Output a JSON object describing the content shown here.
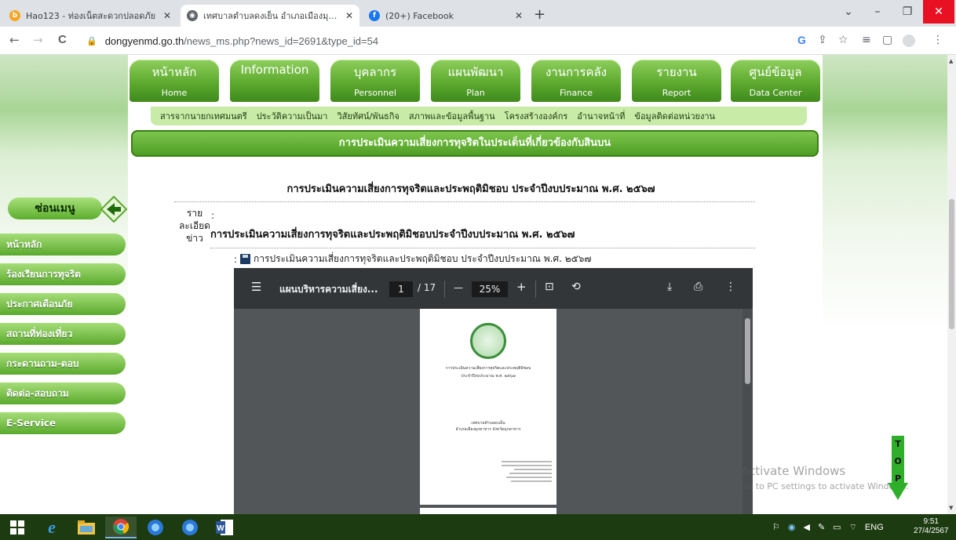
{
  "browser": {
    "tabs": [
      {
        "title": "Hao123 - ท่องเน็ตสะดวกปลอดภัย",
        "favicon_color": "#f5a623",
        "favicon": "b",
        "active": false
      },
      {
        "title": "เทศบาลตำบลดงเย็น อำเภอเมืองมุกดาห",
        "favicon_color": "#5f6368",
        "favicon": "◉",
        "active": true
      },
      {
        "title": "(20+) Facebook",
        "favicon_color": "#1877f2",
        "favicon": "f",
        "active": false
      }
    ],
    "new_tab": "+",
    "window_controls": {
      "dropdown": "⌄",
      "minimize": "–",
      "restore": "❐",
      "close": "✕"
    },
    "url_domain": "dongyenmd.go.th",
    "url_path": "/news_ms.php?news_id=2691&type_id=54",
    "nav": {
      "back": "←",
      "forward": "→",
      "reload": "C"
    }
  },
  "site": {
    "main_nav": [
      {
        "th": "หน้าหลัก",
        "en": "Home"
      },
      {
        "th": "Information",
        "en": ""
      },
      {
        "th": "บุคลากร",
        "en": "Personnel"
      },
      {
        "th": "แผนพัฒนา",
        "en": "Plan"
      },
      {
        "th": "งานการคลัง",
        "en": "Finance"
      },
      {
        "th": "รายงาน",
        "en": "Report"
      },
      {
        "th": "ศูนย์ข้อมูล",
        "en": "Data Center"
      }
    ],
    "sub_nav": [
      "สารจากนายกเทศมนตรี",
      "ประวัติความเป็นมา",
      "วิสัยทัศน์/พันธกิจ",
      "สภาพและข้อมูลพื้นฐาน",
      "โครงสร้างองค์กร",
      "อำนาจหน้าที่",
      "ข้อมูลติดต่อหน่วยงาน"
    ],
    "page_heading": "การประเมินความเสี่ยงการทุจริตในประเด็นที่เกี่ยวข้องกับสินบน",
    "left_menu_title": "ซ่อนเมนู",
    "left_menu": [
      "หน้าหลัก",
      "ร้องเรียนการทุจริต",
      "ประกาศเตือนภัย",
      "สถานที่ท่องเที่ยว",
      "กระดานถาม-ตอบ",
      "ติดต่อ-สอบถาม",
      "E-Service"
    ]
  },
  "article": {
    "title": "การประเมินความเสี่ยงการทุจริตและประพฤติมิชอบ ประจำปีงบประมาณ พ.ศ. ๒๕๖๗",
    "detail_label": "รายละเอียดข่าว",
    "detail_colon": ":",
    "detail_text": "การประเมินความเสี่ยงการทุจริตและประพฤติมิชอบประจำปีงบประมาณ พ.ศ. ๒๕๖๗",
    "attachment_prefix": ":",
    "attachment": "การประเมินความเสี่ยงการทุจริตและประพฤติมิชอบ ประจำปีงบประมาณ พ.ศ. ๒๕๖๗"
  },
  "pdf_viewer": {
    "menu": "☰",
    "doc_title": "แผนบริหารความเสี่ยง...",
    "page": "1",
    "page_total": "/ 17",
    "zoom_out": "—",
    "zoom": "25%",
    "zoom_in": "+",
    "fit": "⊡",
    "rotate": "⟲",
    "download": "⤓",
    "print": "⎙",
    "more": "⋮",
    "doc_lines": [
      "การประเมินความเสี่ยงการทุจริตและประพฤติมิชอบ",
      "ประจำปีงบประมาณ พ.ศ. ๒๕๖๗",
      "เทศบาลตำบลดงเย็น",
      "อำเภอเมืองมุกดาหาร จังหวัดมุกดาหาร"
    ]
  },
  "watermark": {
    "line1": "Activate Windows",
    "line2": "Go to PC settings to activate Windows."
  },
  "top_button": {
    "letters": [
      "T",
      "O",
      "P"
    ]
  },
  "taskbar": {
    "lang": "ENG",
    "time": "9:51",
    "date": "27/4/2567"
  }
}
